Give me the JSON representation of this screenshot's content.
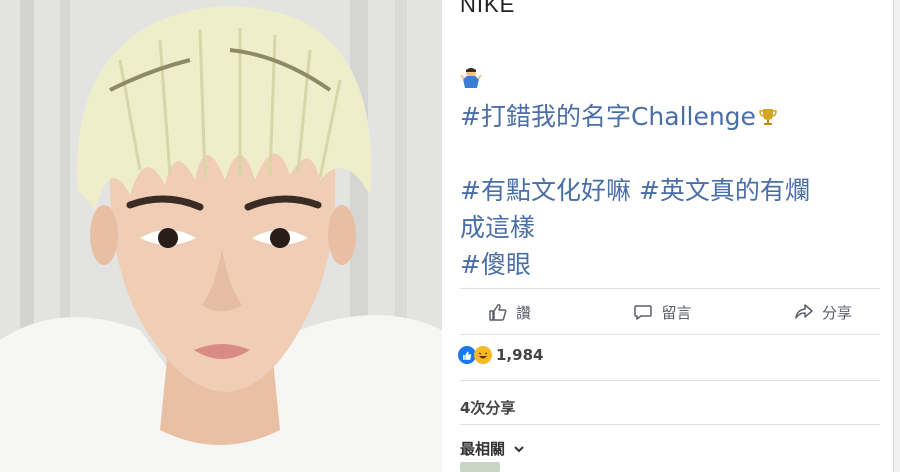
{
  "post": {
    "author_fragment": "NIKE",
    "hashtag_line_1": "#打錯我的名字Challenge",
    "hashtag_line_2": "#有點文化好嘛 #英文真的有爛",
    "hashtag_line_3": "成這樣",
    "hashtag_line_4": "#傻眼"
  },
  "actions": {
    "like_label": "讚",
    "comment_label": "留言",
    "share_label": "分享"
  },
  "stats": {
    "reaction_count": "1,984",
    "share_count": "4次分享"
  },
  "comments": {
    "sort_label": "最相關"
  },
  "colors": {
    "hashtag": "#4a6ea8",
    "like_blue": "#1877f2",
    "haha_yellow": "#f7b928"
  },
  "icons": {
    "like": "thumbs-up-icon",
    "comment": "comment-bubble-icon",
    "share": "share-arrow-icon",
    "emoji": "shrug-emoji-icon",
    "trophy": "trophy-icon",
    "sort": "chevron-down-icon"
  }
}
